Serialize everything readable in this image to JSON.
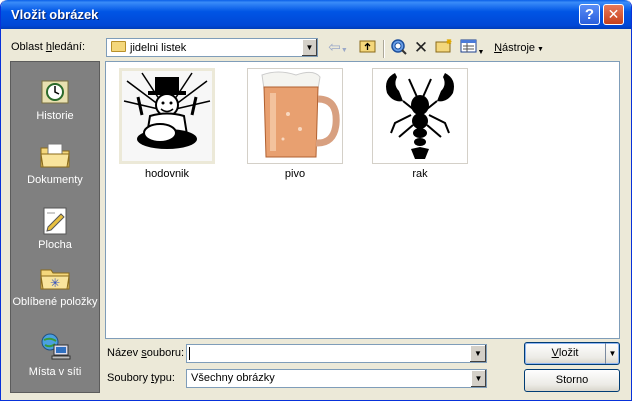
{
  "window": {
    "title": "Vložit obrázek"
  },
  "lookin": {
    "label_pre": "Oblast ",
    "label_u": "h",
    "label_post": "ledání:",
    "value": "jidelni listek"
  },
  "toolbar": {
    "tools_label": "Nástroje",
    "tools_u": "N",
    "tools_rest": "ástroje"
  },
  "places": [
    {
      "label": "Historie",
      "icon": "history-icon"
    },
    {
      "label": "Dokumenty",
      "icon": "documents-icon"
    },
    {
      "label": "Plocha",
      "icon": "desktop-icon"
    },
    {
      "label": "Oblíbené položky",
      "icon": "favorites-icon"
    },
    {
      "label": "Místa v síti",
      "icon": "network-icon"
    }
  ],
  "files": [
    {
      "name": "hodovnik",
      "selected": true
    },
    {
      "name": "pivo",
      "selected": false
    },
    {
      "name": "rak",
      "selected": false
    }
  ],
  "filename": {
    "label_pre": "Název ",
    "label_u": "s",
    "label_post": "ouboru:",
    "value": ""
  },
  "filetype": {
    "label_pre": "Soubory ",
    "label_u": "t",
    "label_post": "ypu:",
    "value": "Všechny obrázky"
  },
  "buttons": {
    "insert_u": "V",
    "insert_rest": "ložit",
    "cancel": "Storno"
  }
}
